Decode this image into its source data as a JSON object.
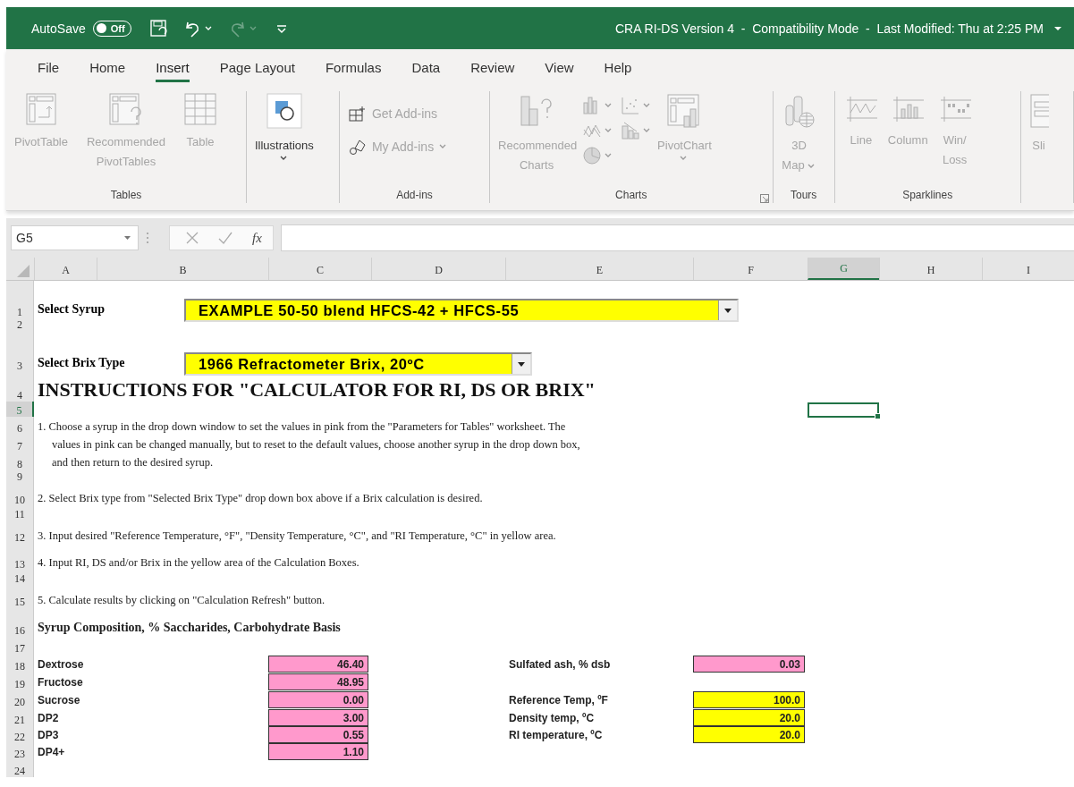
{
  "title_bar": {
    "autosave_label": "AutoSave",
    "autosave": {
      "text": "Off",
      "on": false
    },
    "quick_access": [
      {
        "kind": "save",
        "disabled": false
      },
      {
        "kind": "undo",
        "disabled": false,
        "dropdown": true
      },
      {
        "kind": "redo",
        "disabled": true,
        "dropdown": true
      },
      {
        "kind": "customize",
        "disabled": false
      }
    ],
    "title": "CRA RI-DS Version 4  -  Compatibility Mode  -  Last Modified: Thu at 2:25 PM"
  },
  "ribbon_tabs": [
    {
      "label": "File",
      "selected": false
    },
    {
      "label": "Home",
      "selected": false
    },
    {
      "label": "Insert",
      "selected": true
    },
    {
      "label": "Page Layout",
      "selected": false
    },
    {
      "label": "Formulas",
      "selected": false
    },
    {
      "label": "Data",
      "selected": false
    },
    {
      "label": "Review",
      "selected": false
    },
    {
      "label": "View",
      "selected": false
    },
    {
      "label": "Help",
      "selected": false
    }
  ],
  "ribbon_groups": [
    {
      "label": "Tables",
      "commands": [
        {
          "kind": "pivot-table",
          "label": "PivotTable",
          "disabled": true
        },
        {
          "kind": "recommended-pivot",
          "label": "Recommended PivotTables",
          "disabled": true
        },
        {
          "kind": "table",
          "label": "Table",
          "disabled": true
        }
      ]
    },
    {
      "commands": [
        {
          "kind": "illustrations",
          "label": "Illustrations",
          "disabled": false,
          "dropdown": true
        }
      ]
    },
    {
      "label": "Add-ins",
      "commands": [
        {
          "kind": "get-addins",
          "label": "Get Add-ins",
          "disabled": true
        },
        {
          "kind": "my-addins",
          "label": "My Add-ins",
          "disabled": true,
          "dropdown": true
        }
      ]
    },
    {
      "label": "Charts",
      "launcher": true,
      "commands": [
        {
          "kind": "recommended-charts",
          "label": "Recommended Charts",
          "disabled": true
        },
        {
          "kind": "chart-gallery",
          "disabled": true
        },
        {
          "kind": "pivot-chart",
          "label": "PivotChart",
          "disabled": true,
          "dropdown": true
        }
      ]
    },
    {
      "label": "Tours",
      "commands": [
        {
          "kind": "map",
          "label": "3D Map",
          "disabled": true,
          "dropdown": true
        }
      ]
    },
    {
      "label": "Sparklines",
      "commands": [
        {
          "kind": "spark-line",
          "label": "Line",
          "disabled": true
        },
        {
          "kind": "spark-column",
          "label": "Column",
          "disabled": true
        },
        {
          "kind": "spark-winloss",
          "label": "Win/ Loss",
          "disabled": true
        }
      ]
    },
    {
      "commands": [
        {
          "kind": "slicer",
          "label": "Sli",
          "disabled": true
        }
      ]
    }
  ],
  "formula_bar": {
    "name_box": "G5",
    "function_label": "fx"
  },
  "columns": [
    {
      "label": "A",
      "selected": false
    },
    {
      "label": "B",
      "selected": false
    },
    {
      "label": "C",
      "selected": false
    },
    {
      "label": "D",
      "selected": false
    },
    {
      "label": "E",
      "selected": false
    },
    {
      "label": "F",
      "selected": false
    },
    {
      "label": "G",
      "selected": true
    },
    {
      "label": "H",
      "selected": false
    },
    {
      "label": "I",
      "selected": false
    }
  ],
  "rows": [
    {
      "number": "1",
      "selected": false,
      "kind": "select",
      "label": "Select Syrup",
      "value": "EXAMPLE 50-50 blend HFCS-42 + HFCS-55"
    },
    {
      "number": "2",
      "selected": false
    },
    {
      "number": "3",
      "selected": false,
      "kind": "select",
      "label": "Select Brix Type",
      "value": "1966 Refractometer Brix, 20ºC"
    },
    {
      "number": "4",
      "selected": false,
      "kind": "heading",
      "text": "INSTRUCTIONS FOR \"CALCULATOR FOR RI, DS OR BRIX\""
    },
    {
      "number": "5",
      "selected": true
    },
    {
      "number": "6",
      "selected": false,
      "kind": "text",
      "text": "1. Choose a syrup in the drop down window to set the values in pink from the \"Parameters for Tables\" worksheet. The"
    },
    {
      "number": "7",
      "selected": false,
      "kind": "text-indented",
      "text": "values in pink can be changed manually, but to reset to the default values, choose another syrup in the drop down box,"
    },
    {
      "number": "8",
      "selected": false,
      "kind": "text-indented",
      "text": "and then return to the desired syrup."
    },
    {
      "number": "9",
      "selected": false
    },
    {
      "number": "10",
      "selected": false,
      "kind": "text",
      "text": "2. Select Brix type from \"Selected Brix Type\" drop down box above if a Brix calculation is desired."
    },
    {
      "number": "11",
      "selected": false
    },
    {
      "number": "12",
      "selected": false,
      "kind": "text",
      "text": "3. Input desired \"Reference Temperature, °F\", \"Density Temperature, °C\", and \"RI Temperature, °C\" in yellow area."
    },
    {
      "number": "13",
      "selected": false,
      "kind": "text",
      "text": "4. Input RI, DS and/or Brix in the yellow area of the Calculation Boxes."
    },
    {
      "number": "14",
      "selected": false
    },
    {
      "number": "15",
      "selected": false,
      "kind": "text",
      "text": "5. Calculate results by clicking on \"Calculation Refresh\" button."
    },
    {
      "number": "16",
      "selected": false,
      "kind": "section",
      "text": "Syrup Composition, % Saccharides, Carbohydrate Basis"
    },
    {
      "number": "17",
      "selected": false
    },
    {
      "number": "18",
      "selected": false,
      "kind": "entry",
      "name": "Dextrose",
      "value": "46.40",
      "color": "#ff99cc",
      "side": {
        "name": "Sulfated ash, % dsb",
        "value": "0.03",
        "color": "#ff99cc"
      }
    },
    {
      "number": "19",
      "selected": false,
      "kind": "entry",
      "name": "Fructose",
      "value": "48.95",
      "color": "#ff99cc"
    },
    {
      "number": "20",
      "selected": false,
      "kind": "entry",
      "name": "Sucrose",
      "value": "0.00",
      "color": "#ff99cc",
      "side": {
        "name": "Reference Temp, ºF",
        "value": "100.0",
        "color": "#ffff00"
      }
    },
    {
      "number": "21",
      "selected": false,
      "kind": "entry",
      "name": "DP2",
      "value": "3.00",
      "color": "#ff99cc",
      "side": {
        "name": "Density temp, ºC",
        "value": "20.0",
        "color": "#ffff00"
      }
    },
    {
      "number": "22",
      "selected": false,
      "kind": "entry",
      "name": "DP3",
      "value": "0.55",
      "color": "#ff99cc",
      "side": {
        "name": "RI temperature, ºC",
        "value": "20.0",
        "color": "#ffff00"
      }
    },
    {
      "number": "23",
      "selected": false,
      "kind": "entry",
      "name": "DP4+",
      "value": "1.10",
      "color": "#ff99cc"
    },
    {
      "number": "24",
      "selected": false
    }
  ]
}
